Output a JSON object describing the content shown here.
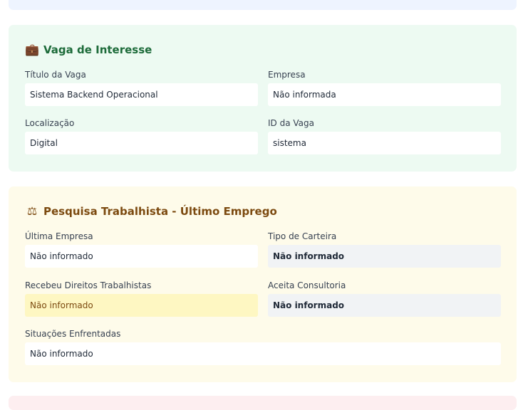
{
  "vaga": {
    "icon": "briefcase-icon",
    "title": "Vaga de Interesse",
    "titulo_label": "Título da Vaga",
    "titulo_value": "Sistema Backend Operacional",
    "empresa_label": "Empresa",
    "empresa_value": "Não informada",
    "localizacao_label": "Localização",
    "localizacao_value": "Digital",
    "id_label": "ID da Vaga",
    "id_value": "sistema"
  },
  "trabalhista": {
    "icon": "balance-scale-icon",
    "title": "Pesquisa Trabalhista - Último Emprego",
    "ultima_empresa_label": "Última Empresa",
    "ultima_empresa_value": "Não informado",
    "tipo_carteira_label": "Tipo de Carteira",
    "tipo_carteira_value": "Não informado",
    "recebeu_label": "Recebeu Direitos Trabalhistas",
    "recebeu_value": "Não informado",
    "aceita_label": "Aceita Consultoria",
    "aceita_value": "Não informado",
    "situacoes_label": "Situações Enfrentadas",
    "situacoes_value": "Não informado"
  },
  "colors": {
    "vaga_bg": "#edfaf2",
    "vaga_title": "#1d6b3a",
    "trab_bg": "#fefbea",
    "trab_title": "#7c4a10",
    "highlight_yellow": "#fef7c2",
    "gray_field": "#f1f3f5"
  }
}
